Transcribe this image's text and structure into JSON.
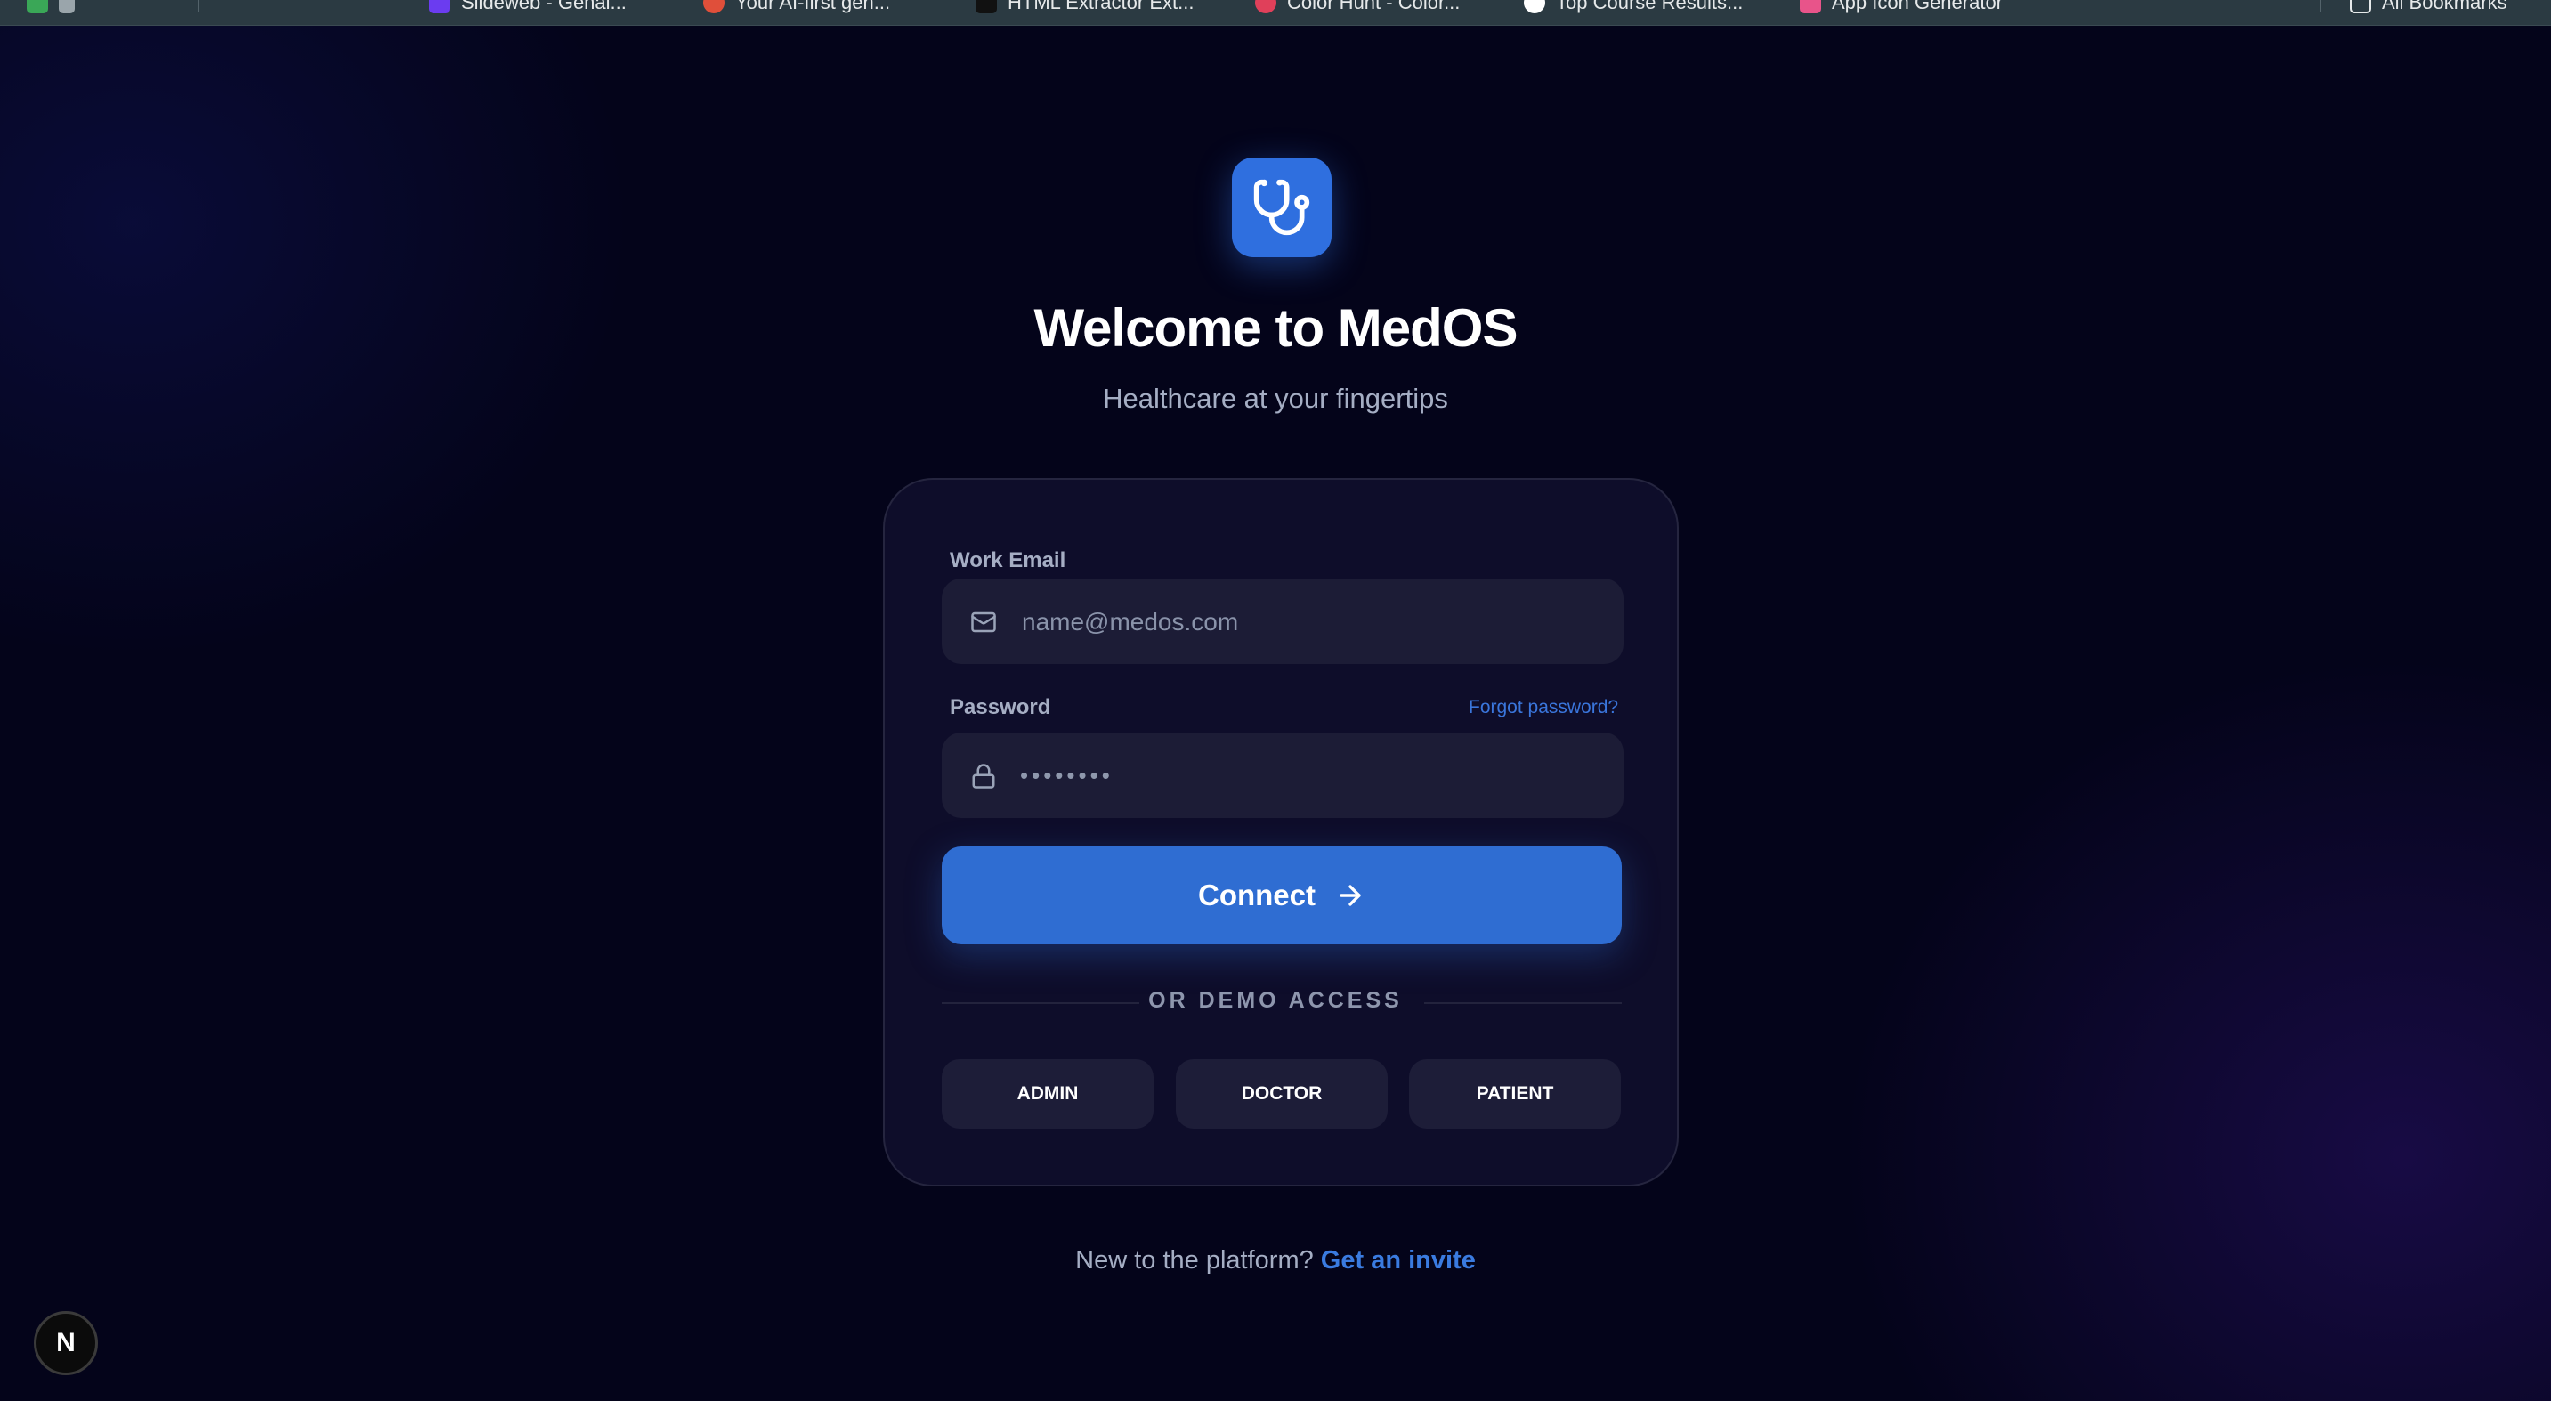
{
  "bookmarks": [
    {
      "label": "Slideweb - Genai..."
    },
    {
      "label": "Your AI-first gen..."
    },
    {
      "label": "HTML Extractor Ext..."
    },
    {
      "label": "Color Hunt - Color..."
    },
    {
      "label": "Top Course Results..."
    },
    {
      "label": "App Icon Generator"
    }
  ],
  "all_bookmarks_label": "All Bookmarks",
  "header": {
    "title": "Welcome to MedOS",
    "subtitle": "Healthcare at your fingertips"
  },
  "form": {
    "email_label": "Work Email",
    "email_placeholder": "name@medos.com",
    "password_label": "Password",
    "forgot_label": "Forgot password?",
    "password_mask": "••••••••",
    "connect_label": "Connect",
    "divider_label": "OR DEMO ACCESS",
    "demo_buttons": [
      "ADMIN",
      "DOCTOR",
      "PATIENT"
    ]
  },
  "footer": {
    "prompt": "New to the platform?",
    "link": "Get an invite"
  },
  "badge_letter": "N",
  "colors": {
    "accent": "#2f6dd2",
    "background": "#04041a",
    "card": "#0e0d2a",
    "input": "#1c1c36",
    "link": "#3a7be0"
  },
  "icons": [
    "stethoscope-icon",
    "mail-icon",
    "lock-icon",
    "arrow-right-icon"
  ]
}
